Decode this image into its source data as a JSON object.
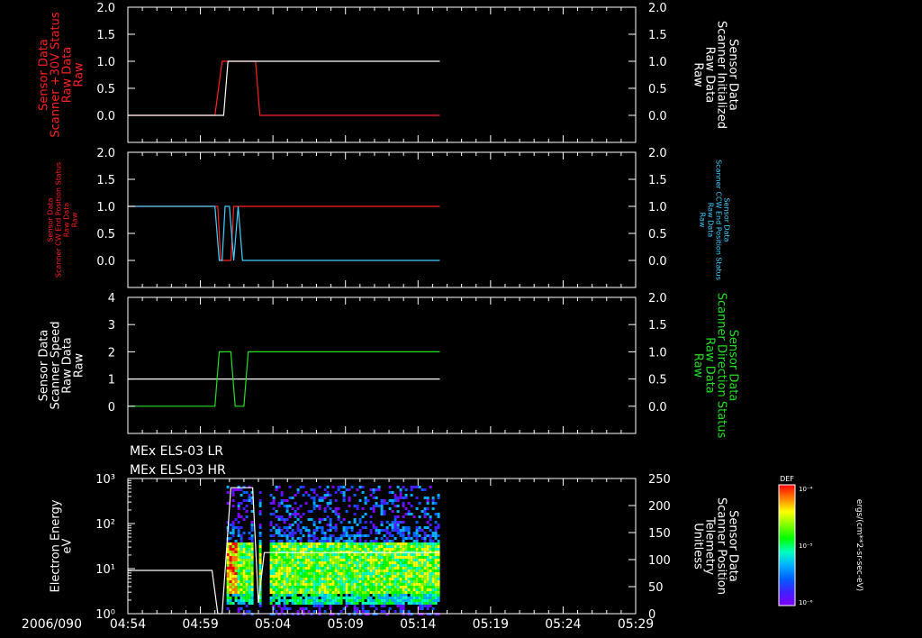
{
  "colors": {
    "background": "#000000",
    "foreground": "#ffffff",
    "red": "#ff2020",
    "cyan": "#40d0ff",
    "green": "#20e020"
  },
  "time_axis": {
    "start_label": "2006/090",
    "ticks": [
      "04:54",
      "04:59",
      "05:04",
      "05:09",
      "05:14",
      "05:19",
      "05:24",
      "05:29"
    ]
  },
  "spectrogram_titles": [
    "MEx ELS-03 LR",
    "MEx ELS-03 HR"
  ],
  "colorbar": {
    "label": "DEF",
    "ticks": [
      "10⁻⁴",
      "10⁻⁵",
      "10⁻⁶"
    ],
    "unit": "ergs/(cm**2-sr-sec-eV)",
    "colormap": [
      "#ff0000",
      "#ff8000",
      "#ffff00",
      "#80ff00",
      "#00ff00",
      "#00ffc0",
      "#00b0ff",
      "#0060ff",
      "#4020ff",
      "#8000ff"
    ]
  },
  "chart_data": [
    {
      "type": "line",
      "panel": 1,
      "xlim": [
        "04:54",
        "05:29"
      ],
      "left_axis": {
        "lines": [
          "Sensor Data",
          "Scanner +30V Status",
          "Raw Data",
          "Raw"
        ],
        "ylim": [
          -0.5,
          2.0
        ],
        "ticks": [
          "2.0",
          "1.5",
          "1.0",
          "0.5",
          "0.0"
        ],
        "color": "#ff2020"
      },
      "right_axis": {
        "lines": [
          "Sensor Data",
          "Scanner Initialized",
          "Raw Data",
          "Raw"
        ],
        "ylim": [
          -0.5,
          2.0
        ],
        "ticks": [
          "2.0",
          "1.5",
          "1.0",
          "0.5",
          "0.0"
        ],
        "color": "#ffffff"
      },
      "series": [
        {
          "axis": "left",
          "color": "#ff2020",
          "x": [
            "04:54",
            "05:00.0",
            "05:00.5",
            "05:00.8",
            "05:02.8",
            "05:03.1",
            "05:15.5"
          ],
          "y": [
            0,
            0,
            1,
            1,
            1,
            0,
            0
          ]
        },
        {
          "axis": "right",
          "color": "#ffffff",
          "x": [
            "04:54",
            "05:00.6",
            "05:00.9",
            "05:15.5"
          ],
          "y": [
            0,
            0,
            1,
            1
          ]
        }
      ]
    },
    {
      "type": "line",
      "panel": 2,
      "xlim": [
        "04:54",
        "05:29"
      ],
      "left_axis": {
        "lines": [
          "Sensor Data",
          "Scanner CW End Position Status",
          "Raw Data",
          "Raw"
        ],
        "ylim": [
          -0.5,
          2.0
        ],
        "ticks": [
          "2.0",
          "1.5",
          "1.0",
          "0.5",
          "0.0"
        ],
        "color": "#ff2020"
      },
      "right_axis": {
        "lines": [
          "Sensor Data",
          "Scanner CCW End Position Status",
          "Raw Data",
          "Raw"
        ],
        "ylim": [
          -0.5,
          2.0
        ],
        "ticks": [
          "2.0",
          "1.5",
          "1.0",
          "0.5",
          "0.0"
        ],
        "color": "#40d0ff"
      },
      "series": [
        {
          "axis": "left",
          "color": "#ff2020",
          "x": [
            "04:54",
            "05:00.2",
            "05:00.4",
            "05:01.1",
            "05:01.3",
            "05:01.6",
            "05:01.8",
            "05:15.5"
          ],
          "y": [
            1,
            1,
            0,
            0,
            1,
            1,
            1,
            1
          ]
        },
        {
          "axis": "right",
          "color": "#40d0ff",
          "x": [
            "04:54",
            "05:00.0",
            "05:00.3",
            "05:00.5",
            "05:00.7",
            "05:01.0",
            "05:01.3",
            "05:01.6",
            "05:01.9",
            "05:15.5"
          ],
          "y": [
            1,
            1,
            0,
            0,
            1,
            1,
            0,
            1,
            0,
            0
          ]
        }
      ]
    },
    {
      "type": "line",
      "panel": 3,
      "xlim": [
        "04:54",
        "05:29"
      ],
      "left_axis": {
        "lines": [
          "Sensor Data",
          "Scanner Speed",
          "Raw Data",
          "Raw"
        ],
        "ylim": [
          -1,
          4
        ],
        "ticks": [
          "4",
          "3",
          "2",
          "1",
          "0"
        ],
        "color": "#ffffff"
      },
      "right_axis": {
        "lines": [
          "Sensor Data",
          "Scanner Direction Status",
          "Raw Data",
          "Raw"
        ],
        "ylim": [
          -0.5,
          2.0
        ],
        "ticks": [
          "2.0",
          "1.5",
          "1.0",
          "0.5",
          "0.0"
        ],
        "color": "#20e020"
      },
      "series": [
        {
          "axis": "left",
          "color": "#ffffff",
          "x": [
            "04:54",
            "05:15.5"
          ],
          "y": [
            1,
            1
          ]
        },
        {
          "axis": "right",
          "color": "#20e020",
          "x": [
            "04:54",
            "05:00.0",
            "05:00.3",
            "05:01.1",
            "05:01.4",
            "05:02.0",
            "05:02.3",
            "05:15.5"
          ],
          "y": [
            0,
            0,
            1,
            1,
            0,
            0,
            1,
            1
          ]
        }
      ]
    },
    {
      "type": "heatmap",
      "panel": 4,
      "xlim": [
        "04:54",
        "05:29"
      ],
      "left_axis": {
        "lines": [
          "Electron Energy",
          "eV"
        ],
        "scale": "log",
        "ylim": [
          1,
          1000
        ],
        "ticks": [
          "10³",
          "10²",
          "10¹",
          "10⁰"
        ],
        "color": "#ffffff"
      },
      "right_axis": {
        "lines": [
          "Sensor Data",
          "Scanner Position",
          "Telemetry",
          "Unitless"
        ],
        "ylim": [
          0,
          250
        ],
        "ticks": [
          "250",
          "200",
          "150",
          "100",
          "50",
          "0"
        ],
        "color": "#ffffff"
      },
      "data_coverage": [
        "05:00.8",
        "05:15.5"
      ],
      "core_energy_range_eV": [
        3,
        40
      ],
      "overlay_series": {
        "axis": "right",
        "color": "#ffffff",
        "x": [
          "04:54",
          "04:59.8",
          "05:00.2",
          "05:00.5",
          "05:01.1",
          "05:02.6",
          "05:03.0",
          "05:03.4",
          "05:15.5"
        ],
        "y": [
          80,
          80,
          0,
          0,
          233,
          233,
          20,
          113,
          113
        ]
      }
    }
  ]
}
